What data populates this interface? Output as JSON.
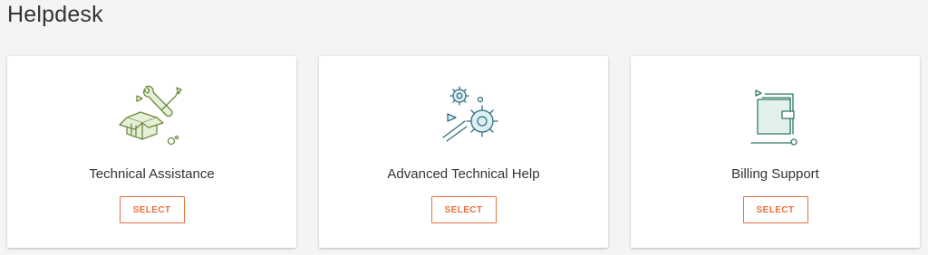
{
  "page": {
    "title": "Helpdesk"
  },
  "cards": [
    {
      "title": "Technical Assistance",
      "button_label": "SELECT",
      "icon": "tools-box-icon"
    },
    {
      "title": "Advanced Technical Help",
      "button_label": "SELECT",
      "icon": "gears-icon"
    },
    {
      "title": "Billing Support",
      "button_label": "SELECT",
      "icon": "wallet-icon"
    }
  ],
  "colors": {
    "accent": "#e8703a",
    "icon_green": "#6b8b3b",
    "icon_green_fill": "#e5efd9",
    "icon_blue": "#2f7183",
    "icon_blue_fill": "#def0f4",
    "icon_teal": "#2e7a62",
    "icon_teal_fill": "#e3f1ea",
    "background": "#f4f4f4"
  }
}
